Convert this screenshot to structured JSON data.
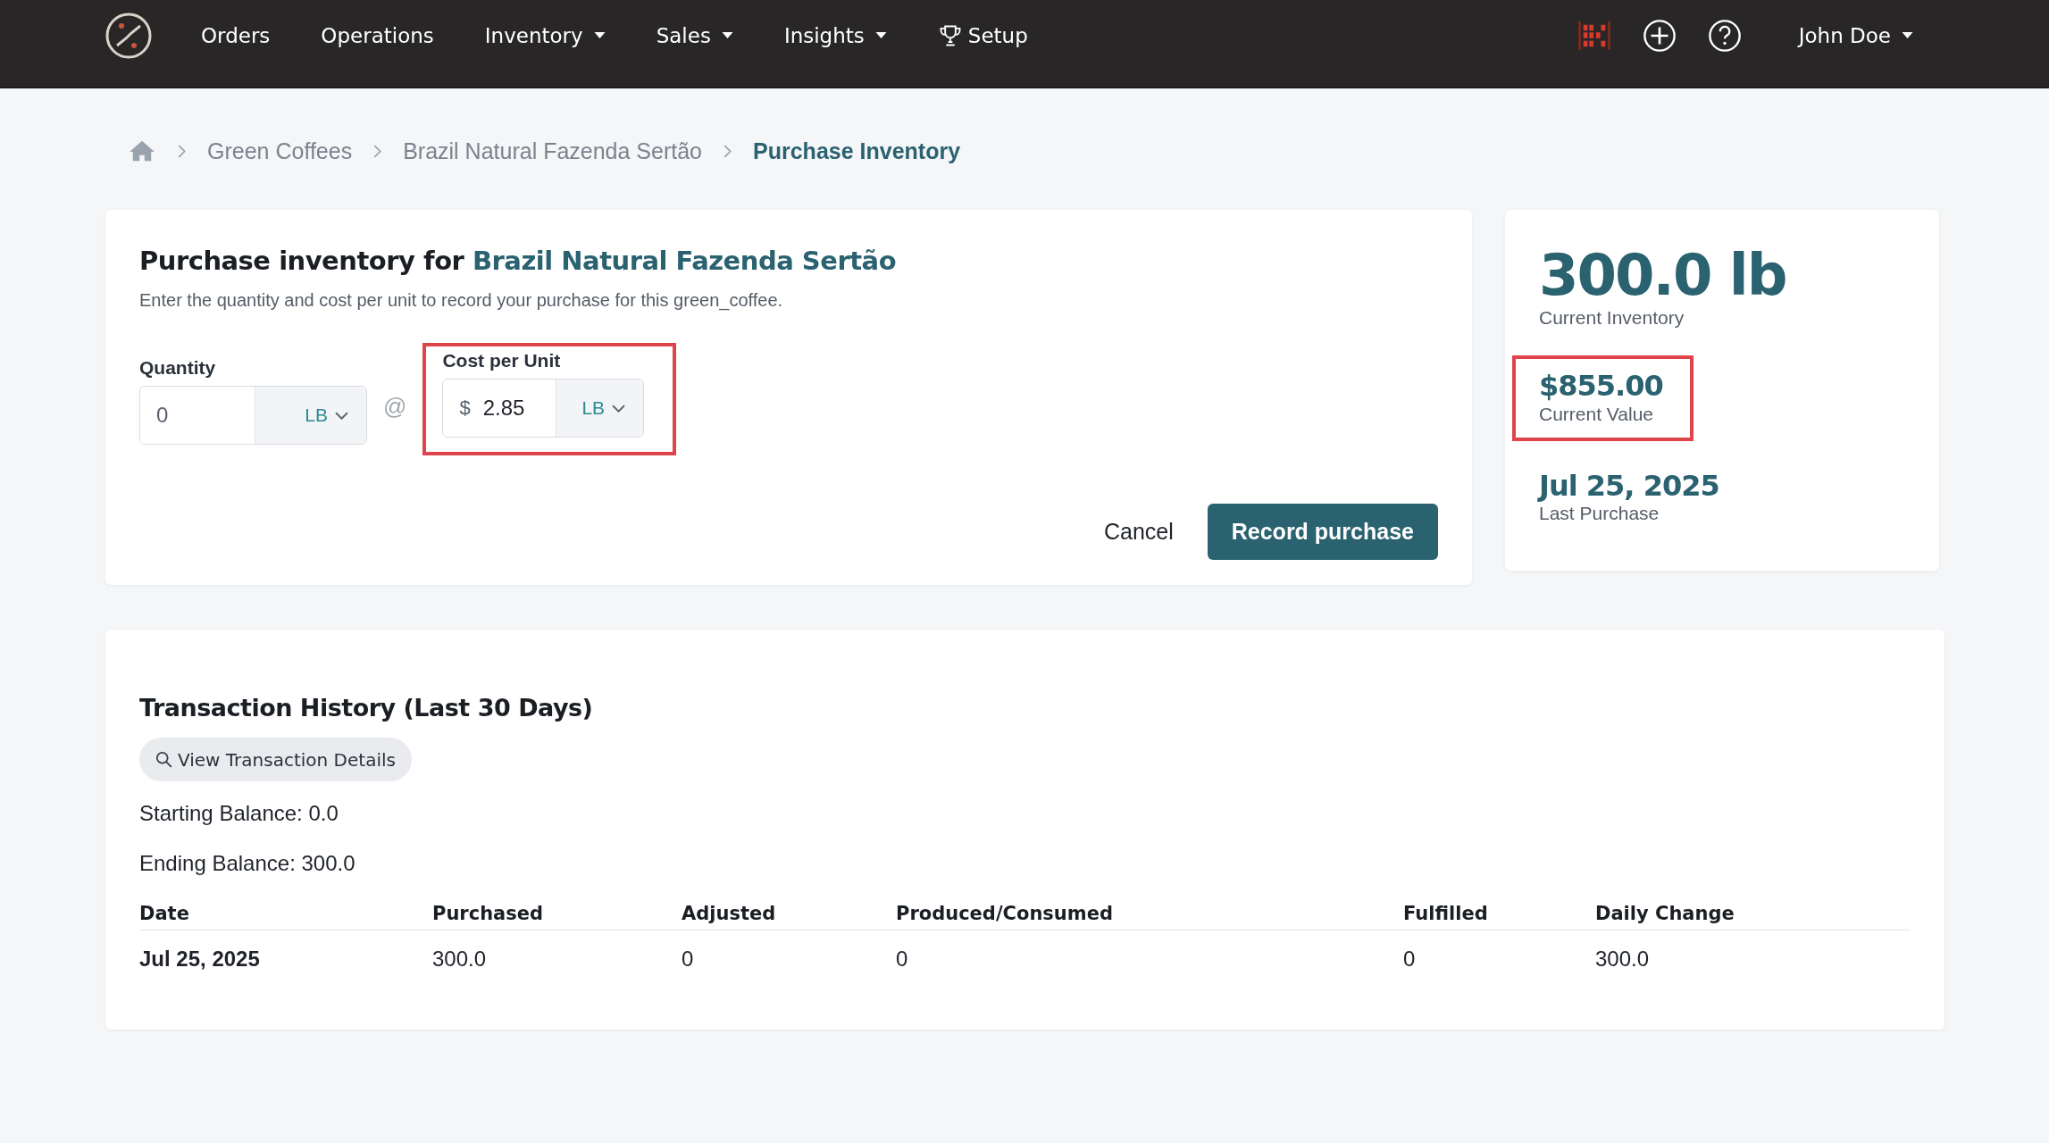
{
  "nav": {
    "items": [
      {
        "label": "Orders",
        "kind": "plain"
      },
      {
        "label": "Operations",
        "kind": "plain"
      },
      {
        "label": "Inventory",
        "kind": "menu"
      },
      {
        "label": "Sales",
        "kind": "menu"
      },
      {
        "label": "Insights",
        "kind": "menu"
      },
      {
        "label": "Setup",
        "kind": "trophy"
      }
    ],
    "user": "John Doe"
  },
  "breadcrumb": [
    {
      "label": "Green Coffees",
      "selected": false
    },
    {
      "label": "Brazil Natural Fazenda Sertão",
      "selected": false
    },
    {
      "label": "Purchase Inventory",
      "selected": true
    }
  ],
  "form": {
    "title": "Purchase inventory for",
    "product": "Brazil Natural Fazenda Sertão",
    "description": "Enter the quantity and cost per unit to record your purchase for this green_coffee.",
    "quantity": {
      "label": "Quantity",
      "value": "0",
      "unit": "LB",
      "highlighted": false
    },
    "separator": "@",
    "cost": {
      "label": "Cost per Unit",
      "prefix": "$",
      "value": "2.85",
      "unit": "LB",
      "highlighted": true
    },
    "buttons": {
      "cancel": "Cancel",
      "submit": "Record purchase"
    }
  },
  "stats": [
    {
      "value": "300.0 lb",
      "label": "Current Inventory",
      "kind": "headline",
      "highlighted": false
    },
    {
      "value": "$855.00",
      "label": "Current Value",
      "kind": "stat",
      "highlighted": true
    },
    {
      "value": "Jul 25, 2025",
      "label": "Last Purchase",
      "kind": "stat",
      "highlighted": false
    }
  ],
  "history": {
    "title": "Transaction History (Last 30 Days)",
    "details_button": "View Transaction Details",
    "starting_balance": "Starting Balance: 0.0",
    "ending_balance": "Ending Balance: 300.0",
    "table": {
      "columns": [
        "Date",
        "Purchased",
        "Adjusted",
        "Produced/Consumed",
        "Fulfilled",
        "Daily Change"
      ],
      "rows": [
        [
          "Jul 25, 2025",
          "300.0",
          "0",
          "0",
          "0",
          "300.0"
        ]
      ]
    }
  }
}
